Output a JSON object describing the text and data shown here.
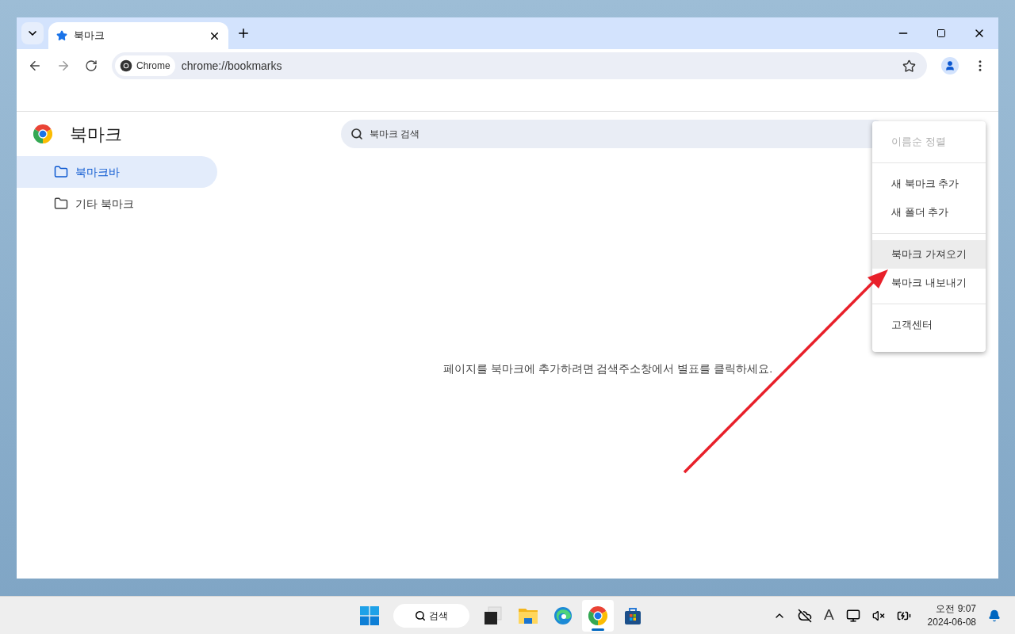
{
  "browser": {
    "tabs": [
      {
        "title": "북마크",
        "selected": true
      }
    ],
    "address_bar": {
      "chip": "Chrome",
      "url": "chrome://bookmarks"
    }
  },
  "page": {
    "title": "북마크",
    "search": {
      "placeholder": "북마크 검색"
    },
    "sidebar": {
      "items": [
        {
          "label": "북마크바",
          "selected": true
        },
        {
          "label": "기타 북마크",
          "selected": false
        }
      ]
    },
    "empty_message": "페이지를 북마크에 추가하려면 검색주소창에서 별표를 클릭하세요."
  },
  "menu": {
    "sections": [
      {
        "items": [
          {
            "label": "이름순 정렬",
            "disabled": true,
            "highlighted": false
          }
        ]
      },
      {
        "items": [
          {
            "label": "새 북마크 추가",
            "disabled": false,
            "highlighted": false
          },
          {
            "label": "새 폴더 추가",
            "disabled": false,
            "highlighted": false
          }
        ]
      },
      {
        "items": [
          {
            "label": "북마크 가져오기",
            "disabled": false,
            "highlighted": true
          },
          {
            "label": "북마크 내보내기",
            "disabled": false,
            "highlighted": false
          }
        ]
      },
      {
        "items": [
          {
            "label": "고객센터",
            "disabled": false,
            "highlighted": false
          }
        ]
      }
    ]
  },
  "taskbar": {
    "search": "검색",
    "apps": [
      {
        "kind": "start",
        "active": false
      },
      {
        "kind": "taskview",
        "active": false
      },
      {
        "kind": "explorer",
        "active": false
      },
      {
        "kind": "edge",
        "active": false
      },
      {
        "kind": "chrome",
        "active": true
      },
      {
        "kind": "store",
        "active": false
      }
    ],
    "tray": {
      "input_indicator": "A",
      "time": "오전 9:07",
      "date": "2024-06-08"
    }
  }
}
